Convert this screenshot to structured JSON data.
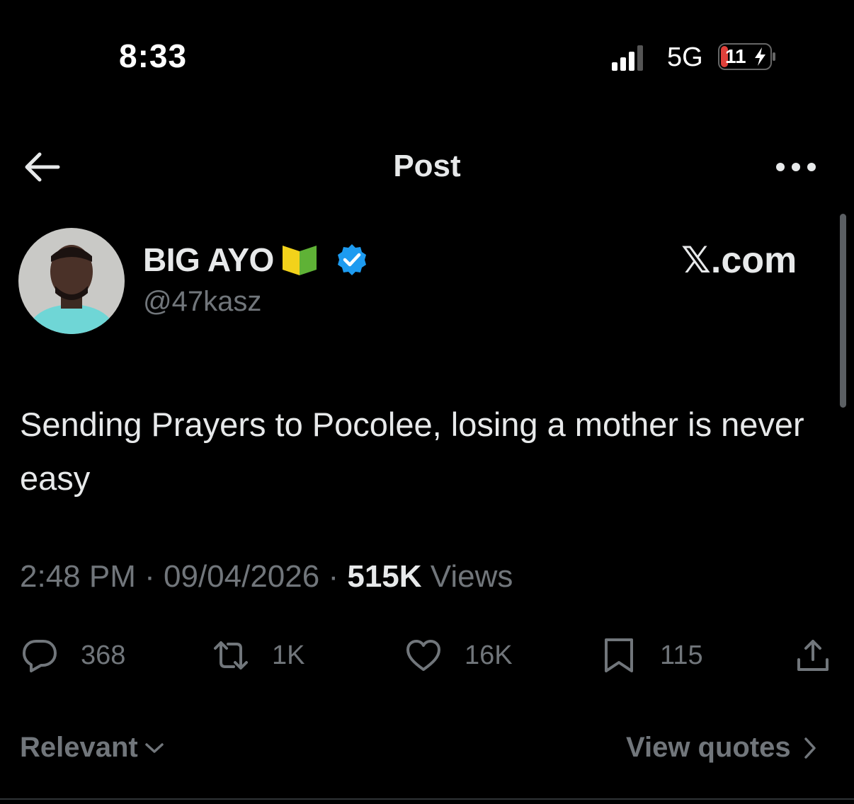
{
  "status_bar": {
    "time": "8:33",
    "network": "5G",
    "battery": "11"
  },
  "header": {
    "title": "Post"
  },
  "author": {
    "display_name": "BIG AYO",
    "handle": "@47kasz",
    "verified": true
  },
  "watermark": "𝕏.com",
  "post": {
    "text": "Sending Prayers to Pocolee, losing a mother is never easy",
    "time": "2:48 PM",
    "date": "09/04/2026",
    "views_count": "515K",
    "views_label": "Views"
  },
  "actions": {
    "replies": "368",
    "reposts": "1K",
    "likes": "16K",
    "bookmarks": "115"
  },
  "footer": {
    "sort_label": "Relevant",
    "quotes_label": "View quotes"
  },
  "icons": {
    "back": "arrow-left-icon",
    "more": "more-dots-icon",
    "reply": "reply-bubble-icon",
    "repost": "repost-icon",
    "like": "heart-icon",
    "bookmark": "bookmark-icon",
    "share": "share-icon",
    "verified": "verified-badge-icon",
    "emoji": "beginner-symbol-icon"
  },
  "colors": {
    "background": "#000000",
    "text": "#e7e9ea",
    "muted": "#71767b",
    "verified": "#1d9bf0",
    "battery_low": "#e0403a"
  }
}
